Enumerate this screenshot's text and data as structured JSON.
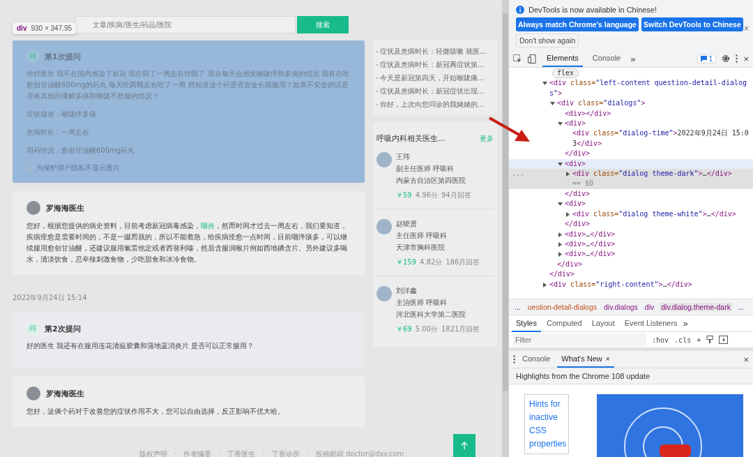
{
  "page": {
    "search": {
      "placeholder": "文章/疾病/医生/药品/医院",
      "button": "搜索"
    },
    "inspect_tooltip": {
      "tag": "div",
      "size": "930 × 347.95"
    },
    "dialogs": [
      {
        "kind": "question",
        "highlighted": true,
        "badge": "问",
        "title": "第1次提问",
        "paragraphs": [
          "你好医生 我不在国内感染了新冠 现在阳了一周左右转阴了 现在每天会感觉喉咙痒和多痰的情况 我有在吃愈创甘油醚600mg的药丸 每天吃两颗左右吃了一周 想知道这个药是否安全长期服用？如果不安全的话是否有其他药缓解多痰和喉咙不舒服的情况？",
          "症状描述：喉咙痒多痰",
          "患病时长：一周左右",
          "用药情况：愈创甘油醚600mg药丸"
        ],
        "note": "为保护用户隐私不显示图片"
      },
      {
        "kind": "answer",
        "highlighted": false,
        "doctor": "罗海海医生",
        "text_before": "您好，根据您提供的病史资料，目前考虑新冠病毒感染，",
        "link": "咽炎",
        "text_after": "，然而时间才过去一周左右，我们要知道，疾病痊愈是需要时间的，不是一蹴而就的，所以不能着急，给疾病痊愈一点时间，目前咽痒痰多，可以继续服用愈创甘油醚，还建议服用氯雷他定或者西替利嗪，然后含服润喉片例如西地碘含片。另外建议多喝水，清淡饮食，忌辛辣刺激食物，少吃甜食和冰冷食物。"
      },
      {
        "kind": "time",
        "text": "2022年9月24日 15:14"
      },
      {
        "kind": "question",
        "highlighted": false,
        "badge": "问",
        "title": "第2次提问",
        "paragraphs": [
          "好的医生 我还有在服用连花清瘟胶囊和蒲地蓝消炎片 是否可以正常服用？"
        ]
      },
      {
        "kind": "answer",
        "highlighted": false,
        "doctor": "罗海海医生",
        "text_before": "您好，这俩个药对于改善您的症状作用不大，您可以自由选择，反正影响不优大哈。"
      }
    ],
    "related_questions": [
      "症状及患病时长：轻微咳嗽 就医...",
      "症状及患病时长：新冠再症状第...",
      "今天是新冠第四天，开始喉咙痛...",
      "症状及患病时长：新冠症状出现...",
      "你好，上次向您问诊的我姥姥的..."
    ],
    "doctors_card": {
      "title": "呼吸内科相关医生...",
      "more": "更多",
      "doctors": [
        {
          "name": "王玮",
          "title": "副主任医师 呼吸科",
          "hospital": "内蒙古自治区第四医院",
          "price": "￥59",
          "rating": "4.96分",
          "answers": "94月回答"
        },
        {
          "name": "赵晓贤",
          "title": "主任医师 呼吸科",
          "hospital": "天津市胸科医院",
          "price": "￥159",
          "rating": "4.82分",
          "answers": "186月回答"
        },
        {
          "name": "刘洋鑫",
          "title": "主治医师 呼吸科",
          "hospital": "河北医科大学第二医院",
          "price": "￥69",
          "rating": "5.00分",
          "answers": "1821月回答"
        }
      ]
    },
    "footer": {
      "separator": "·",
      "links": [
        "版权声明",
        "作者编委",
        "丁香医生",
        "丁香诊所",
        "投稿邮箱 doctor@dxy.com"
      ]
    }
  },
  "devtools": {
    "notice": {
      "text": "DevTools is now available in Chinese!",
      "buttons": [
        "Always match Chrome's language",
        "Switch DevTools to Chinese"
      ],
      "close": "×",
      "dismiss": "Don't show again"
    },
    "tabs": [
      {
        "label": "Elements",
        "selected": true
      },
      {
        "label": "Console",
        "selected": false
      }
    ],
    "more_tabs": "»",
    "issues": "1",
    "close": "×",
    "flex_badge": "flex",
    "dom_tree": [
      {
        "open": "<div class=\"left-content question-detail-dialogs\">",
        "expanded": true,
        "selected": false,
        "hovered": false,
        "close": "</div>",
        "children": [
          {
            "open": "<div class=\"dialogs\">",
            "expanded": true,
            "selected": false,
            "hovered": false,
            "close": "</div>",
            "children": [
              {
                "open": "<div></div>",
                "selected": false,
                "hovered": false
              },
              {
                "open": "<div>",
                "expanded": true,
                "selected": false,
                "hovered": false,
                "close": "</div>",
                "children": [
                  {
                    "open": "<div class=\"dialog-time\">2022年9月24日 15:03</div>",
                    "selected": false,
                    "hovered": false
                  }
                ]
              },
              {
                "open": "<div>",
                "expanded": true,
                "selected": false,
                "hovered": true,
                "close": "</div>",
                "children": [
                  {
                    "open": "<div class=\"dialog theme-dark\">…</div>",
                    "expanded": false,
                    "selected": true,
                    "hovered": false,
                    "suffix": "== $0",
                    "gutter": "..."
                  }
                ]
              },
              {
                "open": "<div>",
                "expanded": true,
                "selected": false,
                "hovered": false,
                "close": "</div>",
                "children": [
                  {
                    "open": "<div class=\"dialog theme-white\">…</div>",
                    "expanded": false,
                    "selected": false,
                    "hovered": false
                  }
                ]
              },
              {
                "open": "<div>…</div>",
                "expanded": false,
                "selected": false,
                "hovered": false
              },
              {
                "open": "<div>…</div>",
                "expanded": false,
                "selected": false,
                "hovered": false
              },
              {
                "open": "<div>…</div>",
                "expanded": false,
                "selected": false,
                "hovered": false
              }
            ]
          }
        ]
      },
      {
        "open": "<div class=\"right-content\">…</div>",
        "expanded": false,
        "selected": false,
        "hovered": false
      }
    ],
    "breadcrumbs": [
      {
        "label": "...",
        "selected": false
      },
      {
        "label": "uestion-detail-dialogs",
        "selected": false
      },
      {
        "label": "div.dialogs",
        "selected": false
      },
      {
        "label": "div",
        "selected": false
      },
      {
        "label": "div.dialog.theme-dark",
        "selected": true
      },
      {
        "label": "...",
        "selected": false
      }
    ],
    "style_tabs": [
      {
        "label": "Styles",
        "selected": true
      },
      {
        "label": "Computed",
        "selected": false
      },
      {
        "label": "Layout",
        "selected": false
      },
      {
        "label": "Event Listeners",
        "selected": false
      }
    ],
    "style_more": "»",
    "filter": {
      "placeholder": "Filter",
      "hov": ":hov",
      "cls": ".cls",
      "plus": "+"
    },
    "drawer_tabs": [
      {
        "label": "Console",
        "selected": false
      },
      {
        "label": "What's New",
        "selected": true,
        "close": "×"
      }
    ],
    "drawer_close": "×",
    "whats_new_title": "Highlights from the Chrome 108 update",
    "whats_new_link": "Hints for inactive CSS properties"
  }
}
